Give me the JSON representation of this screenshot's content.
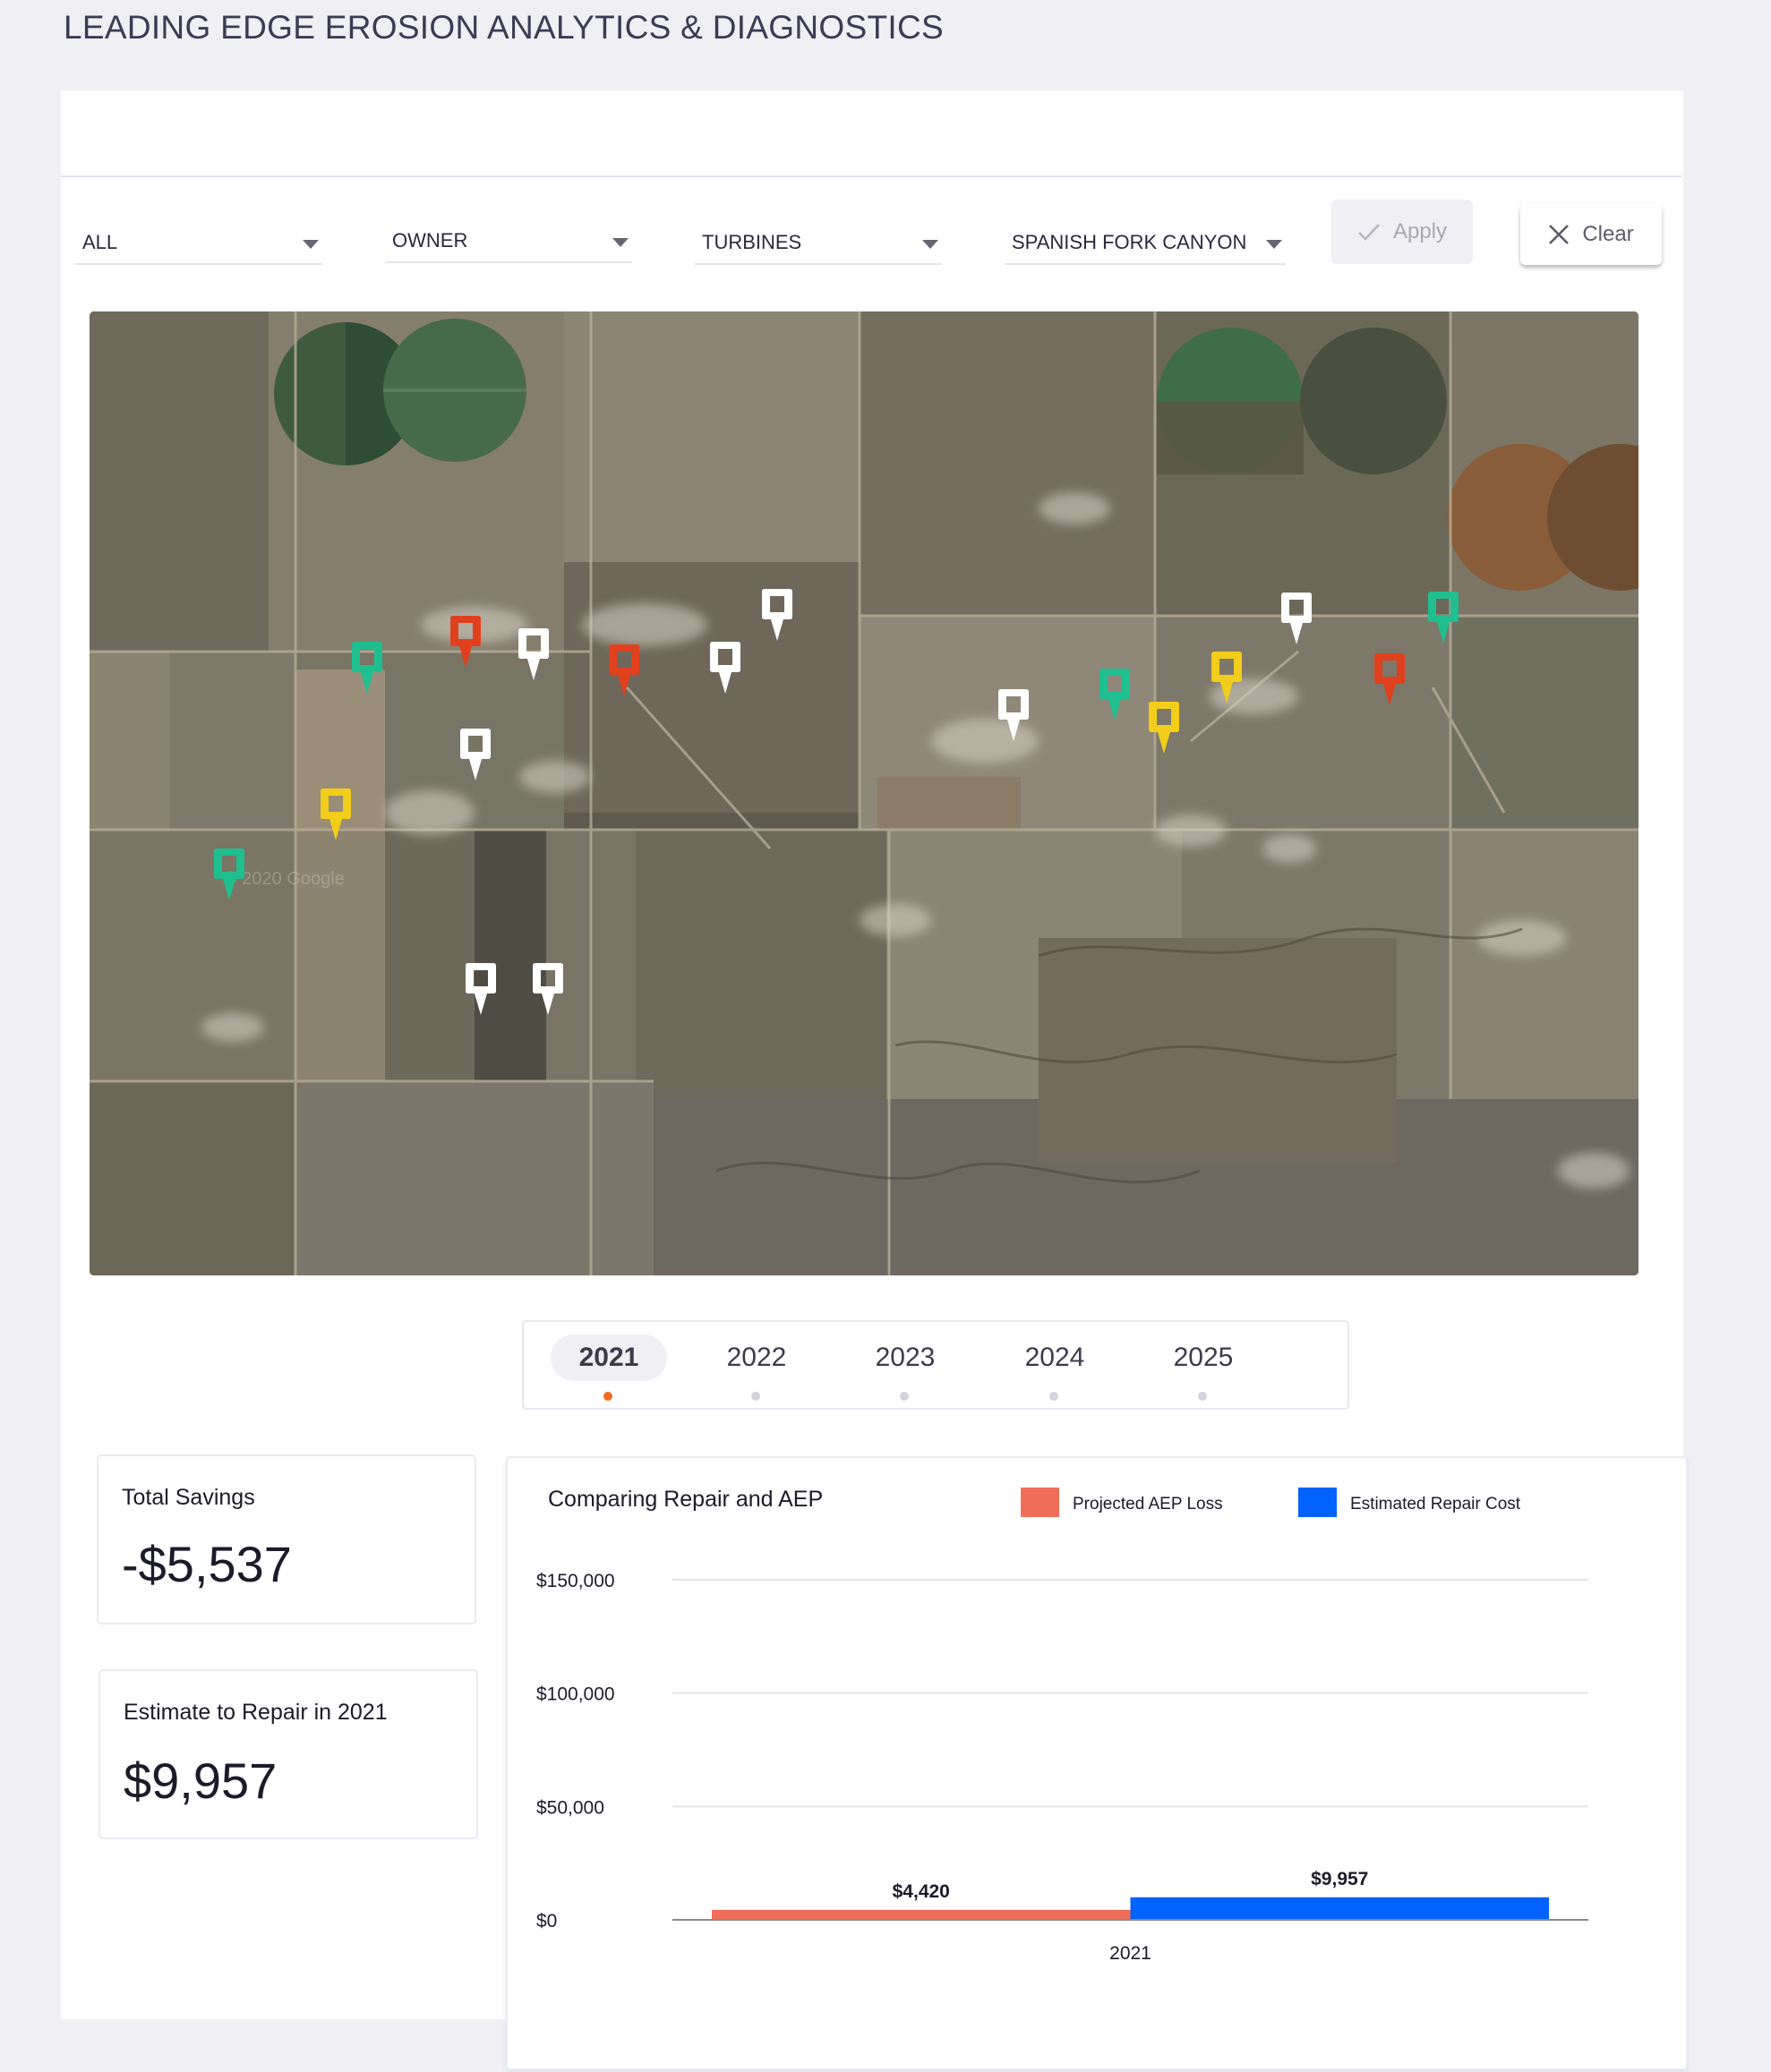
{
  "header": {
    "title": "LEADING EDGE EROSION ANALYTICS & DIAGNOSTICS"
  },
  "filters": [
    {
      "name": "all",
      "value": "ALL"
    },
    {
      "name": "owner",
      "value": "OWNER"
    },
    {
      "name": "turbines",
      "value": "TURBINES"
    },
    {
      "name": "site",
      "value": "SPANISH FORK CANYON"
    }
  ],
  "actions": {
    "apply_label": "Apply",
    "apply_icon": "check-icon",
    "clear_label": "Clear",
    "clear_icon": "close-icon"
  },
  "map": {
    "type": "satellite",
    "watermark": "© 2020 Google",
    "status_colors": {
      "green": "#1fbf8f",
      "red": "#e0401e",
      "yellow": "#f2cd1a",
      "white": "#ffffff"
    },
    "markers": [
      {
        "status": "green"
      },
      {
        "status": "red"
      },
      {
        "status": "white"
      },
      {
        "status": "red"
      },
      {
        "status": "white"
      },
      {
        "status": "white"
      },
      {
        "status": "white"
      },
      {
        "status": "yellow"
      },
      {
        "status": "green"
      },
      {
        "status": "white"
      },
      {
        "status": "white"
      },
      {
        "status": "white"
      },
      {
        "status": "green"
      },
      {
        "status": "yellow"
      },
      {
        "status": "yellow"
      },
      {
        "status": "white"
      },
      {
        "status": "red"
      },
      {
        "status": "green"
      }
    ]
  },
  "years": {
    "selected": "2021",
    "active_color": "#f26a1f",
    "items": [
      "2021",
      "2022",
      "2023",
      "2024",
      "2025"
    ]
  },
  "cards": {
    "total_savings": {
      "title": "Total Savings",
      "value": "-$5,537"
    },
    "estimate": {
      "title": "Estimate to Repair in 2021",
      "value": "$9,957"
    }
  },
  "chart_data": {
    "type": "bar",
    "title": "Comparing Repair and AEP",
    "categories": [
      "2021"
    ],
    "series": [
      {
        "name": "Projected AEP Loss",
        "color": "#ee6e58",
        "values": [
          4420
        ],
        "labels": [
          "$4,420"
        ]
      },
      {
        "name": "Estimated Repair Cost",
        "color": "#0062ff",
        "values": [
          9957
        ],
        "labels": [
          "$9,957"
        ]
      }
    ],
    "yticks": [
      0,
      50000,
      100000,
      150000
    ],
    "ytick_labels": [
      "$0",
      "$50,000",
      "$100,000",
      "$150,000"
    ],
    "ylim": [
      0,
      150000
    ],
    "xlabel": "",
    "ylabel": "",
    "grid": true,
    "legend": "top-right"
  }
}
